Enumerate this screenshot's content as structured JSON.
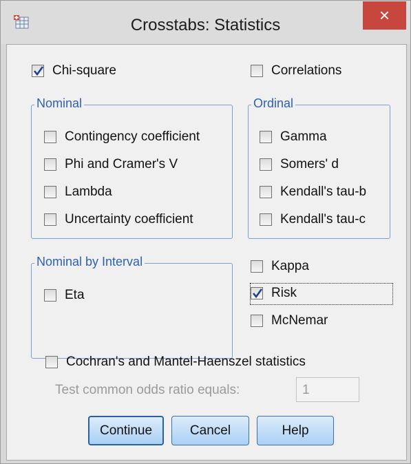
{
  "window": {
    "title": "Crosstabs: Statistics",
    "close_label": "×",
    "app_icon": "spss-crosstabs-icon"
  },
  "chi_square": {
    "label": "Chi-square",
    "checked": true
  },
  "correlations": {
    "label": "Correlations",
    "checked": false
  },
  "nominal": {
    "title": "Nominal",
    "items": [
      {
        "label": "Contingency coefficient",
        "checked": false
      },
      {
        "label": "Phi and Cramer's V",
        "checked": false
      },
      {
        "label": "Lambda",
        "checked": false
      },
      {
        "label": "Uncertainty coefficient",
        "checked": false
      }
    ]
  },
  "ordinal": {
    "title": "Ordinal",
    "items": [
      {
        "label": "Gamma",
        "checked": false
      },
      {
        "label": "Somers' d",
        "checked": false
      },
      {
        "label": "Kendall's tau-b",
        "checked": false
      },
      {
        "label": "Kendall's tau-c",
        "checked": false
      }
    ]
  },
  "nominal_by_interval": {
    "title": "Nominal by Interval",
    "items": [
      {
        "label": "Eta",
        "checked": false
      }
    ]
  },
  "kappa": {
    "label": "Kappa",
    "checked": false
  },
  "risk": {
    "label": "Risk",
    "checked": true
  },
  "mcnemar": {
    "label": "McNemar",
    "checked": false
  },
  "cochran": {
    "label": "Cochran's and Mantel-Haenszel statistics",
    "checked": false
  },
  "odds": {
    "label": "Test common odds ratio equals:",
    "value": "1"
  },
  "buttons": {
    "continue": "Continue",
    "cancel": "Cancel",
    "help": "Help"
  },
  "colors": {
    "group_border": "#7a9fd0",
    "group_title": "#2f5fb4",
    "checkmark": "#1f3f8f",
    "close_button": "#c7463e",
    "button_fill": "#a9d0f4"
  }
}
